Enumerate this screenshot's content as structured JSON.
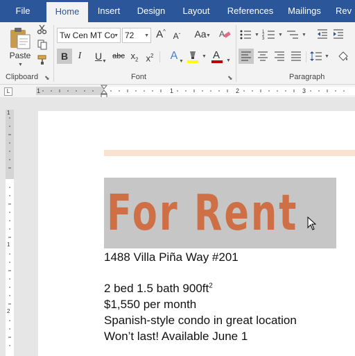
{
  "tabs": [
    {
      "label": "File"
    },
    {
      "label": "Home"
    },
    {
      "label": "Insert"
    },
    {
      "label": "Design"
    },
    {
      "label": "Layout"
    },
    {
      "label": "References"
    },
    {
      "label": "Mailings"
    },
    {
      "label": "Rev"
    }
  ],
  "active_tab": "Home",
  "ribbon": {
    "clipboard": {
      "group_label": "Clipboard",
      "paste_label": "Paste",
      "paste_icon": "clipboard-paste-icon",
      "cut_icon": "scissors-icon",
      "copy_icon": "copy-icon",
      "format_painter_icon": "paintbrush-icon"
    },
    "font": {
      "group_label": "Font",
      "font_name": "Tw Cen MT Co",
      "font_size": "72",
      "grow_label": "A",
      "shrink_label": "A",
      "case_label": "Aa",
      "clear_icon": "eraser-icon",
      "bold_label": "B",
      "italic_label": "I",
      "underline_label": "U",
      "strike_label": "abc",
      "subscript_label": "x",
      "subscript_sub": "2",
      "superscript_label": "x",
      "superscript_sup": "2",
      "effects_label": "A",
      "highlight_icon": "highlighter-icon",
      "font_color_label": "A",
      "highlight_color": "#ffff00",
      "font_color": "#c00000"
    },
    "paragraph": {
      "group_label": "Paragraph",
      "bullets_icon": "bullet-list-icon",
      "numbering_icon": "numbered-list-icon",
      "multilevel_icon": "multilevel-list-icon",
      "decrease_indent_icon": "decrease-indent-icon",
      "increase_indent_icon": "increase-indent-icon",
      "align_left_icon": "align-left-icon",
      "center_icon": "align-center-icon",
      "align_right_icon": "align-right-icon",
      "justify_icon": "justify-icon",
      "line_spacing_icon": "line-spacing-icon",
      "shading_icon": "shading-icon"
    }
  },
  "ruler": {
    "tab_selector": "L",
    "numbers": [
      "1",
      "1",
      "2",
      "3"
    ],
    "vertical_numbers": [
      "1",
      "1",
      "2"
    ]
  },
  "document": {
    "title": "For Rent",
    "lines": [
      "1488 Villa Piña Way #201",
      "",
      "2 bed 1.5 bath 900ft",
      "$1,550 per month",
      "Spanish-style condo in great location",
      "Won’t last! Available June 1"
    ],
    "superscript": "2",
    "title_color": "#cf6f46",
    "accent_color": "#fae2d3",
    "selection_color": "#c6c6c6"
  },
  "colors": {
    "brand": "#2b579a",
    "ribbon_bg": "#f3f3f3"
  }
}
